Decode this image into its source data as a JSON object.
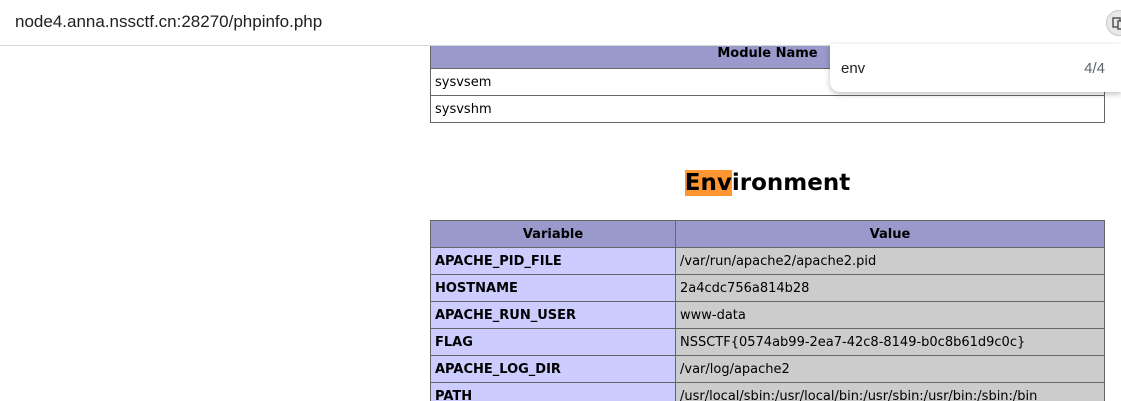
{
  "browser": {
    "url": "node4.anna.nssctf.cn:28270/phpinfo.php"
  },
  "find_bar": {
    "query": "env",
    "count": "4/4"
  },
  "modules_table": {
    "header": "Module Name",
    "rows": [
      "sysvsem",
      "sysvshm"
    ]
  },
  "environment": {
    "title_highlight": "Env",
    "title_rest": "ironment",
    "headers": [
      "Variable",
      "Value"
    ],
    "rows": [
      {
        "variable": "APACHE_PID_FILE",
        "value": "/var/run/apache2/apache2.pid"
      },
      {
        "variable": "HOSTNAME",
        "value": "2a4cdc756a814b28"
      },
      {
        "variable": "APACHE_RUN_USER",
        "value": "www-data"
      },
      {
        "variable": "FLAG",
        "value": "NSSCTF{0574ab99-2ea7-42c8-8149-b0c8b61d9c0c}"
      },
      {
        "variable": "APACHE_LOG_DIR",
        "value": "/var/log/apache2"
      },
      {
        "variable": "PATH",
        "value": "/usr/local/sbin:/usr/local/bin:/usr/sbin:/usr/bin:/sbin:/bin"
      }
    ]
  },
  "colors": {
    "header_bg": "#9999cc",
    "key_bg": "#ccccff",
    "value_bg": "#cccccc",
    "find_highlight": "#ff9632"
  }
}
